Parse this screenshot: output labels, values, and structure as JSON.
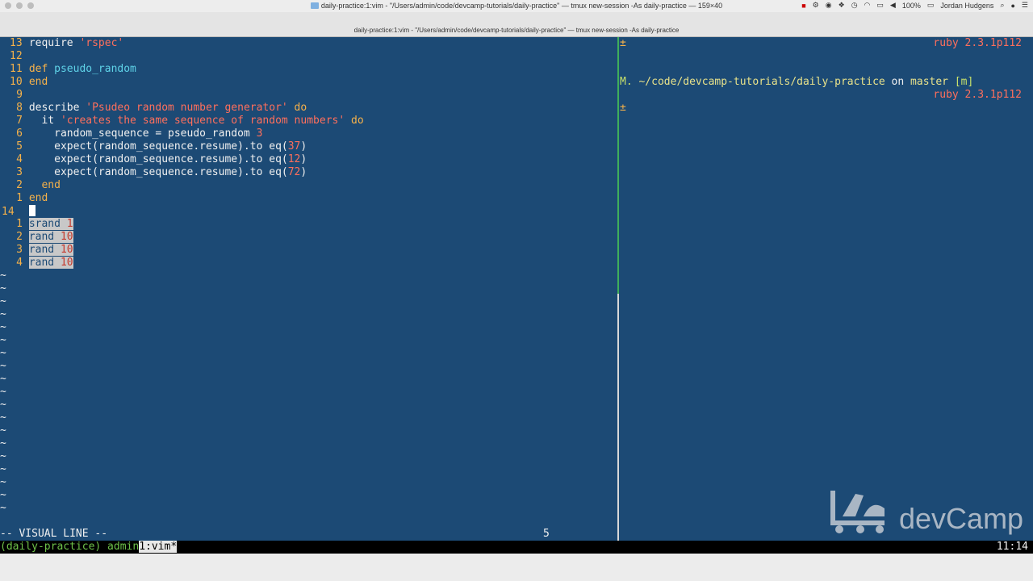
{
  "menubar": {
    "window_title": "daily-practice:1:vim - \"/Users/admin/code/devcamp-tutorials/daily-practice\" — tmux new-session -As daily-practice — 159×40",
    "battery": "100%",
    "user": "Jordan Hudgens"
  },
  "titlebar": {
    "subtitle": "daily-practice:1:vim - \"/Users/admin/code/devcamp-tutorials/daily-practice\" — tmux new-session -As daily-practice"
  },
  "editor": {
    "lines": [
      {
        "num": "13",
        "parts": [
          [
            "plain",
            "require "
          ],
          [
            "str",
            "'rspec'"
          ]
        ]
      },
      {
        "num": "12",
        "parts": []
      },
      {
        "num": "11",
        "parts": [
          [
            "kw",
            "def "
          ],
          [
            "fn",
            "pseudo_random"
          ]
        ]
      },
      {
        "num": "10",
        "parts": [
          [
            "kw",
            "end"
          ]
        ]
      },
      {
        "num": "9",
        "parts": []
      },
      {
        "num": "8",
        "parts": [
          [
            "plain",
            "describe "
          ],
          [
            "str",
            "'Psudeo random number generator'"
          ],
          [
            "kw",
            " do"
          ]
        ]
      },
      {
        "num": "7",
        "parts": [
          [
            "plain",
            "  it "
          ],
          [
            "str",
            "'creates the same sequence of random numbers'"
          ],
          [
            "kw",
            " do"
          ]
        ]
      },
      {
        "num": "6",
        "parts": [
          [
            "plain",
            "    random_sequence = pseudo_random "
          ],
          [
            "num",
            "3"
          ]
        ]
      },
      {
        "num": "5",
        "parts": [
          [
            "plain",
            "    expect(random_sequence.resume).to eq("
          ],
          [
            "num",
            "37"
          ],
          [
            "plain",
            ")"
          ]
        ]
      },
      {
        "num": "4",
        "parts": [
          [
            "plain",
            "    expect(random_sequence.resume).to eq("
          ],
          [
            "num",
            "12"
          ],
          [
            "plain",
            ")"
          ]
        ]
      },
      {
        "num": "3",
        "parts": [
          [
            "plain",
            "    expect(random_sequence.resume).to eq("
          ],
          [
            "num",
            "72"
          ],
          [
            "plain",
            ")"
          ]
        ]
      },
      {
        "num": "2",
        "parts": [
          [
            "kw",
            "  end"
          ]
        ]
      },
      {
        "num": "1",
        "parts": [
          [
            "kw",
            "end"
          ]
        ]
      },
      {
        "num": "14",
        "parts": [],
        "cursor": true
      },
      {
        "num": "1",
        "parts": [
          [
            "sel",
            "srand "
          ],
          [
            "selnum",
            "1"
          ]
        ]
      },
      {
        "num": "2",
        "parts": [
          [
            "sel",
            "rand "
          ],
          [
            "selnum",
            "10"
          ]
        ]
      },
      {
        "num": "3",
        "parts": [
          [
            "sel",
            "rand "
          ],
          [
            "selnum",
            "10"
          ]
        ]
      },
      {
        "num": "4",
        "parts": [
          [
            "sel",
            "rand "
          ],
          [
            "selnum",
            "10"
          ]
        ]
      }
    ],
    "tilde_count": 19,
    "tilde": "~",
    "mode": "-- VISUAL LINE --",
    "selected_count": "5"
  },
  "terminal": {
    "lines": [
      {
        "text": "±",
        "right": "ruby 2.3.1p112"
      },
      {
        "text": "",
        "right": ""
      },
      {
        "text": "",
        "right": ""
      },
      {
        "prompt_marker": "M.",
        "path": "~/code/devcamp-tutorials/daily-practice",
        "on": " on ",
        "branch": "master",
        "flag": " [m]"
      },
      {
        "text": "",
        "right": "ruby 2.3.1p112"
      },
      {
        "text": "±",
        "right": ""
      }
    ]
  },
  "tmux": {
    "session": "(daily-practice) admin",
    "window": "1:vim*",
    "clock": "11:14"
  },
  "logo": {
    "text": "devCamp"
  }
}
